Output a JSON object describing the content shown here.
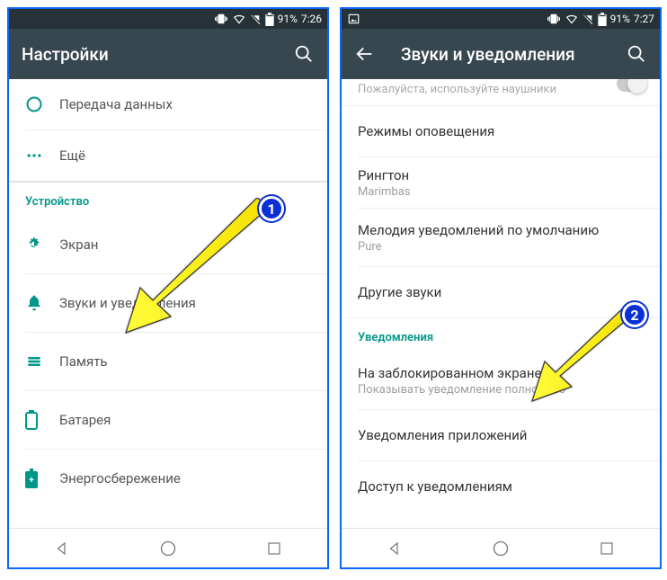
{
  "left": {
    "status": {
      "battery_pct": "91%",
      "time": "7:26"
    },
    "appbar": {
      "title": "Настройки"
    },
    "items": {
      "data_usage": "Передача данных",
      "more": "Ещё",
      "section_device": "Устройство",
      "display": "Экран",
      "sounds": "Звуки и уведомления",
      "memory": "Память",
      "battery": "Батарея",
      "power_saving": "Энергосбережение"
    }
  },
  "right": {
    "status": {
      "battery_pct": "91%",
      "time": "7:27"
    },
    "appbar": {
      "title": "Звуки и уведомления"
    },
    "partial": {
      "sub": "Пожалуйста, используйте наушники"
    },
    "items": {
      "alert_modes": "Режимы оповещения",
      "ringtone": {
        "title": "Рингтон",
        "sub": "Marimbas"
      },
      "notif_sound": {
        "title": "Мелодия уведомлений по умолчанию",
        "sub": "Pure"
      },
      "other_sounds": "Другие звуки",
      "section_notifications": "Уведомления",
      "lock_screen": {
        "title": "На заблокированном экране",
        "sub": "Показывать уведомление полностью"
      },
      "app_notifications": "Уведомления приложений",
      "notif_access": "Доступ к уведомлениям"
    }
  },
  "annotations": {
    "badge1": "1",
    "badge2": "2"
  }
}
